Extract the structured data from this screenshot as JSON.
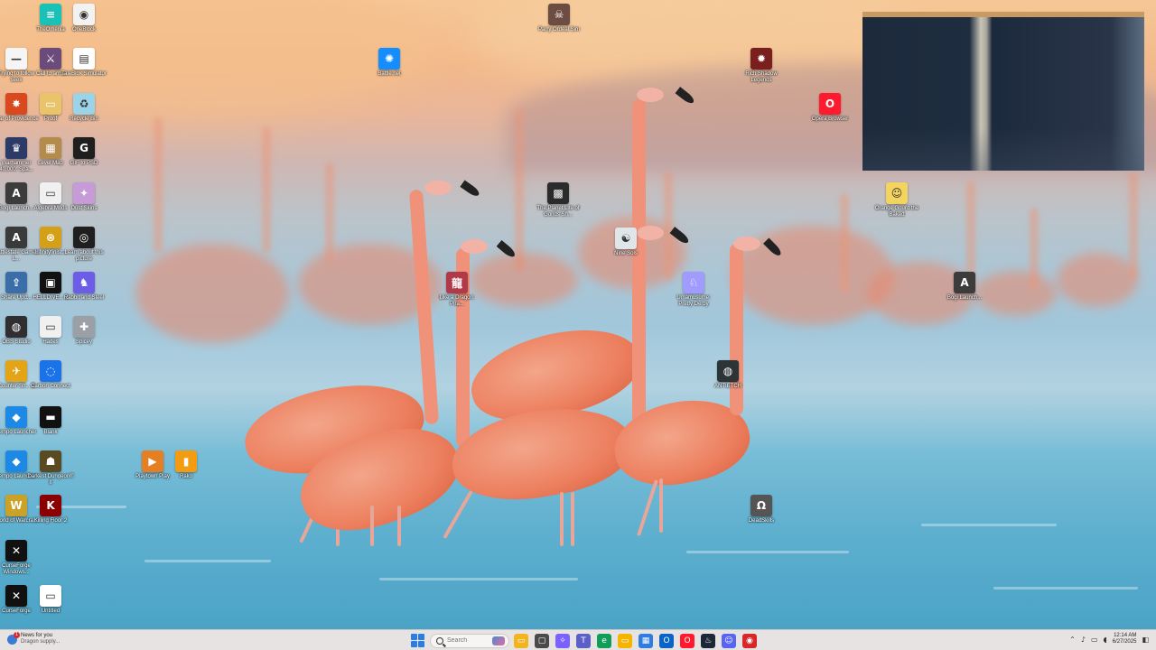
{
  "desktop": {
    "icons": [
      {
        "label": "TheOmenia",
        "icon": "omen-icon",
        "color": "#1ac1b7",
        "glyph": "≡"
      },
      {
        "label": "OneBlock",
        "icon": "eye-icon",
        "color": "#f2f2f2",
        "glyph": "◉"
      },
      {
        "label": "Trying to follow seek",
        "icon": "line-icon",
        "color": "#f5f5f5",
        "glyph": "—"
      },
      {
        "label": "Call to arms",
        "icon": "game-icon",
        "color": "#6b4b7a",
        "glyph": "⚔"
      },
      {
        "label": "TaleBlox Simulator",
        "icon": "document-icon",
        "color": "#ffffff",
        "glyph": "▤"
      },
      {
        "label": "Star of Providence",
        "icon": "star-icon",
        "color": "#d9481f",
        "glyph": "✸"
      },
      {
        "label": "Proof",
        "icon": "folder-icon",
        "color": "#e9c46a",
        "glyph": "▭"
      },
      {
        "label": "Recycle Bin",
        "icon": "recycle-bin-icon",
        "color": "#9bd3e8",
        "glyph": "♻"
      },
      {
        "label": "Warhammer 40,000: Spa...",
        "icon": "warhammer-icon",
        "color": "#2b3a67",
        "glyph": "♛"
      },
      {
        "label": "Level Map",
        "icon": "map-icon",
        "color": "#b38b4d",
        "glyph": "▦"
      },
      {
        "label": "GIF to PSD",
        "icon": "gif-icon",
        "color": "#1f1f1f",
        "glyph": "G"
      },
      {
        "label": "Bogi Launch...",
        "icon": "bogi-icon",
        "color": "#3c3c3c",
        "glyph": "A"
      },
      {
        "label": "Algebra Mods",
        "icon": "folder-icon",
        "color": "#f0f0f0",
        "glyph": "▭"
      },
      {
        "label": "Dust Skins",
        "icon": "skins-icon",
        "color": "#c79ad8",
        "glyph": "✦"
      },
      {
        "label": "Battlestate Games L...",
        "icon": "battlestate-icon",
        "color": "#3a3a3a",
        "glyph": "A"
      },
      {
        "label": "Infinityfinist...",
        "icon": "infinity-icon",
        "color": "#d4a017",
        "glyph": "⊛"
      },
      {
        "label": "Learn about this picture",
        "icon": "camera-icon",
        "color": "#1f1f1f",
        "glyph": "◎"
      },
      {
        "label": "Share Upd...",
        "icon": "share-icon",
        "color": "#3b6ea8",
        "glyph": "⇪"
      },
      {
        "label": "HELLDIVE... 2",
        "icon": "helldivers-icon",
        "color": "#111111",
        "glyph": "▣"
      },
      {
        "label": "Rabbit and Steel",
        "icon": "rabbit-icon",
        "color": "#6c5ce7",
        "glyph": "♞"
      },
      {
        "label": "OBS Studio",
        "icon": "obs-icon",
        "color": "#302e31",
        "glyph": "◍"
      },
      {
        "label": "Hades",
        "icon": "hades-icon",
        "color": "#f0f0f0",
        "glyph": "▭"
      },
      {
        "label": "Spicey",
        "icon": "spicey-icon",
        "color": "#9aa0a6",
        "glyph": "✚"
      },
      {
        "label": "Counter-Str... 2",
        "icon": "cs2-icon",
        "color": "#e3a517",
        "glyph": "✈"
      },
      {
        "label": "Carbon Connect",
        "icon": "carbon-icon",
        "color": "#1a73e8",
        "glyph": "◌"
      },
      {
        "label": "Tempo Launcher",
        "icon": "tempo-icon",
        "color": "#1e88e5",
        "glyph": "◆"
      },
      {
        "label": "Blank",
        "icon": "blank-icon",
        "color": "#111111",
        "glyph": "▬"
      },
      {
        "label": "Tempo Launcher",
        "icon": "tempo-icon",
        "color": "#1e88e5",
        "glyph": "◆"
      },
      {
        "label": "Darkest Dungeon® II",
        "icon": "darkest-dungeon-icon",
        "color": "#5a4a22",
        "glyph": "☗"
      },
      {
        "label": "World of Warcra...",
        "icon": "wow-icon",
        "color": "#c9a227",
        "glyph": "W"
      },
      {
        "label": "Killing Floor 2",
        "icon": "killing-floor-icon",
        "color": "#8b0000",
        "glyph": "K"
      },
      {
        "label": "CurseForge Windows...",
        "icon": "curseforge-icon",
        "color": "#111111",
        "glyph": "✕"
      },
      {
        "label": "CurseForge",
        "icon": "curseforge-icon",
        "color": "#111111",
        "glyph": "✕"
      },
      {
        "label": "Untitled",
        "icon": "document-icon",
        "color": "#ffffff",
        "glyph": "▭"
      },
      {
        "label": "Parry Ordeal Sim",
        "icon": "parry-icon",
        "color": "#6d4c41",
        "glyph": "☠"
      },
      {
        "label": "Battle.net",
        "icon": "battlenet-icon",
        "color": "#148eff",
        "glyph": "✺"
      },
      {
        "label": "Rich Shadow Legends",
        "icon": "raid-icon",
        "color": "#7b1e1e",
        "glyph": "✹"
      },
      {
        "label": "Opera Browser",
        "icon": "opera-icon",
        "color": "#ff1b2d",
        "glyph": "O"
      },
      {
        "label": "The Planet Lite of Gonds Sh...",
        "icon": "planet-icon",
        "color": "#2b2b2b",
        "glyph": "▩"
      },
      {
        "label": "Orange Gourd the Baked",
        "icon": "orange-icon",
        "color": "#f4d35e",
        "glyph": "☺"
      },
      {
        "label": "Nine Sols",
        "icon": "nine-sols-icon",
        "color": "#dfe6e9",
        "glyph": "☯"
      },
      {
        "label": "Bogi Launch...",
        "icon": "bogi-icon",
        "color": "#3c3c3c",
        "glyph": "A"
      },
      {
        "label": "Like a Dragon: Pira...",
        "icon": "dragon-icon",
        "color": "#b23a48",
        "glyph": "龍"
      },
      {
        "label": "Umamusume: Pretty Derby",
        "icon": "umamusume-icon",
        "color": "#a29bfe",
        "glyph": "♘"
      },
      {
        "label": "ANTIETCH",
        "icon": "antietch-icon",
        "color": "#2d3436",
        "glyph": "◍"
      },
      {
        "label": "Playtown Play",
        "icon": "playtown-icon",
        "color": "#e67e22",
        "glyph": "▶"
      },
      {
        "label": "Rako",
        "icon": "rako-icon",
        "color": "#f39c12",
        "glyph": "▮"
      },
      {
        "label": "DeadSkills",
        "icon": "deadskills-icon",
        "color": "#555555",
        "glyph": "Ω"
      }
    ]
  },
  "webcam": {
    "icon": "webcam-feed"
  },
  "taskbar": {
    "news_title": "News for you",
    "news_sub": "Dragon supply...",
    "news_badge": "1",
    "search_placeholder": "Search",
    "apps": [
      {
        "name": "file-explorer-icon",
        "color": "#f3b51f",
        "glyph": "▭"
      },
      {
        "name": "task-view-icon",
        "color": "#4a4a4a",
        "glyph": "▢"
      },
      {
        "name": "copilot-icon",
        "color": "#7b61ff",
        "glyph": "✧"
      },
      {
        "name": "teams-icon",
        "color": "#5b5fc7",
        "glyph": "T"
      },
      {
        "name": "edge-icon",
        "color": "#0f9d58",
        "glyph": "e"
      },
      {
        "name": "folder-icon",
        "color": "#f4b400",
        "glyph": "▭"
      },
      {
        "name": "store-icon",
        "color": "#2f7de1",
        "glyph": "▦"
      },
      {
        "name": "outlook-icon",
        "color": "#0a64c8",
        "glyph": "O"
      },
      {
        "name": "opera-icon",
        "color": "#ff1b2d",
        "glyph": "O"
      },
      {
        "name": "steam-icon",
        "color": "#1b2838",
        "glyph": "♨"
      },
      {
        "name": "discord-icon",
        "color": "#5865f2",
        "glyph": "☺"
      },
      {
        "name": "game-icon",
        "color": "#d62828",
        "glyph": "◉"
      }
    ],
    "time": "12:14 AM",
    "date": "6/27/2025"
  }
}
